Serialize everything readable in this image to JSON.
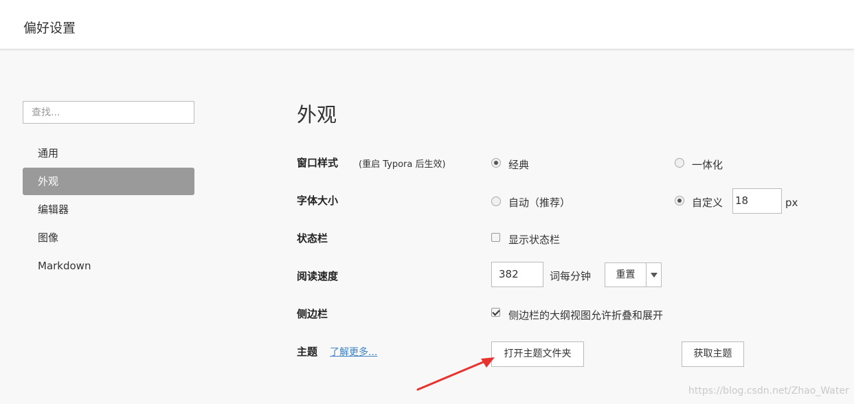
{
  "window": {
    "title": "偏好设置"
  },
  "sidebar": {
    "search_placeholder": "查找...",
    "items": [
      {
        "label": "通用"
      },
      {
        "label": "外观"
      },
      {
        "label": "编辑器"
      },
      {
        "label": "图像"
      },
      {
        "label": "Markdown"
      }
    ],
    "active_index": 1
  },
  "main": {
    "heading": "外观",
    "window_style": {
      "label": "窗口样式",
      "note": "(重启 Typora 后生效)",
      "options": [
        {
          "label": "经典",
          "checked": true
        },
        {
          "label": "一体化",
          "checked": false
        }
      ]
    },
    "font_size": {
      "label": "字体大小",
      "options": [
        {
          "label": "自动（推荐）",
          "checked": false
        },
        {
          "label": "自定义",
          "checked": true
        }
      ],
      "value": "18",
      "unit": "px"
    },
    "status_bar": {
      "label": "状态栏",
      "checkbox_label": "显示状态栏",
      "checked": false
    },
    "reading_speed": {
      "label": "阅读速度",
      "value": "382",
      "unit": "词每分钟",
      "reset_label": "重置"
    },
    "sidebar_option": {
      "label": "侧边栏",
      "checkbox_label": "侧边栏的大纲视图允许折叠和展开",
      "checked": true
    },
    "theme": {
      "label": "主题",
      "learn_more": "了解更多...",
      "open_folder": "打开主题文件夹",
      "get_themes": "获取主题"
    }
  },
  "colors": {
    "accent_link": "#4183c4",
    "active_nav_bg": "#9a9a9a",
    "annotation_arrow": "#e8322e"
  },
  "watermark": "https://blog.csdn.net/Zhao_Water"
}
